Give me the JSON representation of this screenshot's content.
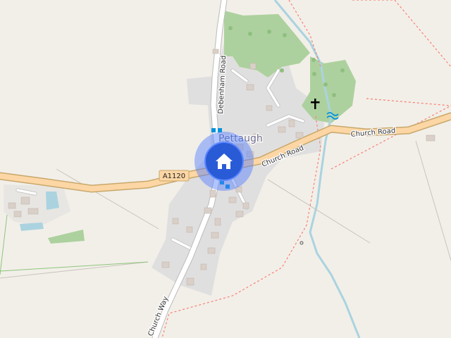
{
  "map": {
    "place_name": "Pettaugh",
    "roads": {
      "church_road_west": "Church Road",
      "church_road_east": "Church Road",
      "debenham_road": "Debenham Road",
      "church_way": "Church Way"
    },
    "route_ref": "A1120",
    "marker_icon": "home-icon",
    "colors": {
      "background": "#f2efe9",
      "residential": "#e0dfdf",
      "park": "#add19e",
      "main_road": "#fcd6a4",
      "road_casing": "#c8a86a",
      "water": "#aad3df",
      "marker_halo": "#4f7cff",
      "marker": "#2a5bd7",
      "footpath": "#fa8072",
      "bus_stop": "#0092da"
    }
  }
}
